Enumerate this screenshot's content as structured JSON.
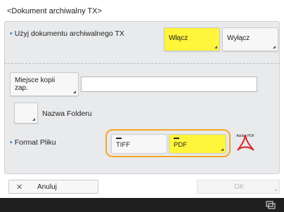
{
  "screen": {
    "title": "<Dokument archiwalny TX>"
  },
  "use_archive": {
    "label": "Użyj dokumentu archiwalnego TX",
    "on_label": "Włącz",
    "off_label": "Wyłącz",
    "selected": "on"
  },
  "save_location": {
    "button_label": "Miejsce kopii zap.",
    "value": ""
  },
  "folder_name": {
    "label": "Nazwa Folderu"
  },
  "file_format": {
    "label": "Format Pliku",
    "options": [
      "TIFF",
      "PDF"
    ],
    "selected": "PDF",
    "icon_text": "Adobe PDF"
  },
  "actions": {
    "cancel_label": "Anuluj",
    "ok_label": "OK"
  },
  "colors": {
    "selected": "#fff53a",
    "focus_ring": "#f5a623",
    "bullet": "#2f7fd8"
  }
}
